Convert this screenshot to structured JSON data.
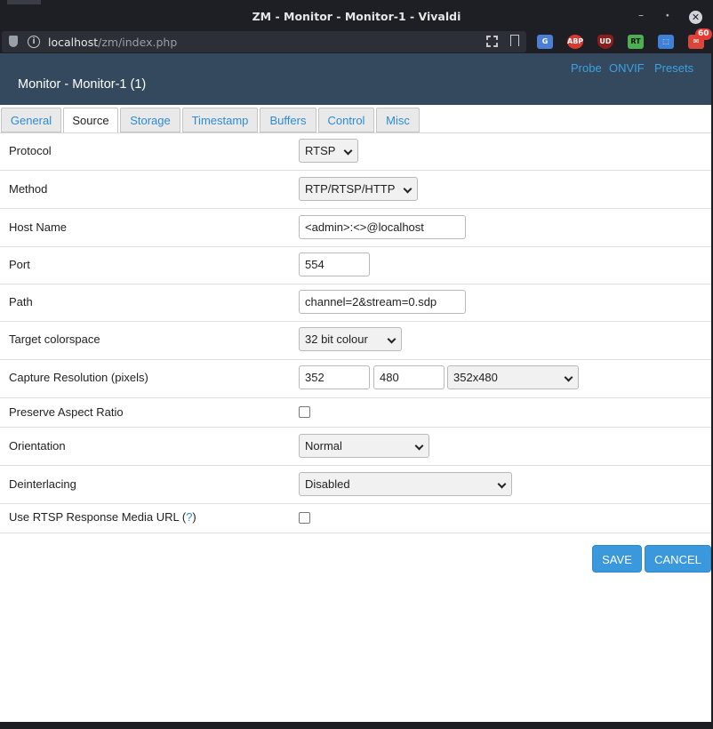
{
  "window": {
    "title": "ZM - Monitor - Monitor-1 - Vivaldi",
    "minimize_glyph": "–",
    "maximize_glyph": "⬩",
    "close_glyph": "✕"
  },
  "address": {
    "host": "localhost",
    "path": "/zm/index.php",
    "extensions": [
      {
        "name": "translate-icon",
        "label": "G"
      },
      {
        "name": "adblock-plus-icon",
        "label": "ABP"
      },
      {
        "name": "ublock-origin-icon",
        "label": "UD"
      },
      {
        "name": "rt-extension-icon",
        "label": "RT"
      },
      {
        "name": "puzzle-extension-icon",
        "label": "⬚"
      },
      {
        "name": "mail-icon",
        "label": "✉"
      }
    ],
    "mail_badge": "60"
  },
  "header": {
    "heading": "Monitor - Monitor-1 (1)",
    "links": {
      "probe": "Probe",
      "onvif": "ONVIF",
      "presets": "Presets"
    }
  },
  "tabs": [
    "General",
    "Source",
    "Storage",
    "Timestamp",
    "Buffers",
    "Control",
    "Misc"
  ],
  "active_tab": "Source",
  "form": {
    "protocol": {
      "label": "Protocol",
      "value": "RTSP"
    },
    "method": {
      "label": "Method",
      "value": "RTP/RTSP/HTTP"
    },
    "host_name": {
      "label": "Host Name",
      "value": "<admin>:<>@localhost"
    },
    "port": {
      "label": "Port",
      "value": "554"
    },
    "path": {
      "label": "Path",
      "value": "channel=2&stream=0.sdp"
    },
    "target_colorspace": {
      "label": "Target colorspace",
      "value": "32 bit colour"
    },
    "capture_resolution": {
      "label": "Capture Resolution (pixels)",
      "width": "352",
      "height": "480",
      "preset": "352x480"
    },
    "preserve_aspect_ratio": {
      "label": "Preserve Aspect Ratio",
      "checked": false
    },
    "orientation": {
      "label": "Orientation",
      "value": "Normal"
    },
    "deinterlacing": {
      "label": "Deinterlacing",
      "value": "Disabled"
    },
    "rtsp_response_media_url": {
      "label_prefix": "Use RTSP Response Media URL (",
      "help": "?",
      "label_suffix": ")",
      "checked": false
    }
  },
  "buttons": {
    "save": "SAVE",
    "cancel": "CANCEL"
  },
  "colors": {
    "header_bg": "#34495e",
    "link": "#3da0e0",
    "button": "#3a98dc"
  }
}
